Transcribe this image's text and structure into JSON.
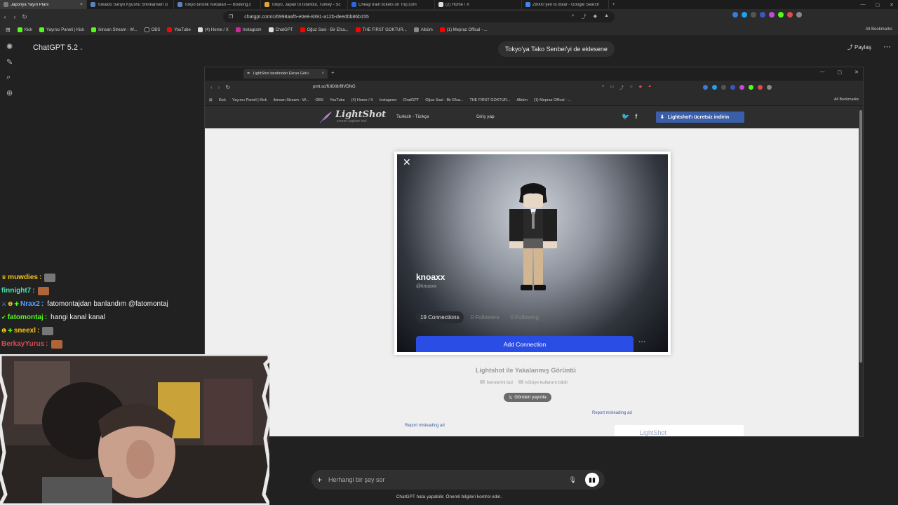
{
  "outer_tabs": [
    {
      "title": "Japonya Yayın Planı",
      "color": "#7a7a7a",
      "active": true
    },
    {
      "title": "Tokaido Sanyo Kyushu Shinkansen G",
      "color": "#5f7fbf",
      "active": false
    },
    {
      "title": "Tokyo turistik noktaları — Booking.c",
      "color": "#5f7fbf",
      "active": false
    },
    {
      "title": "Tokyo, Japan to Istanbul, Turkey - Sc",
      "color": "#e2a33b",
      "active": false
    },
    {
      "title": "Cheap train tickets on Trip.com",
      "color": "#2b67d8",
      "active": false
    },
    {
      "title": "(2) Home / X",
      "color": "#dddddd",
      "active": false
    },
    {
      "title": "29000 yen to dolar - Google Search",
      "color": "#4285f4",
      "active": false
    }
  ],
  "outer_url": "chatgpt.com/c/6998aaf5-e0e8-8391-a12b-deed0b86b155",
  "bookmarks": [
    {
      "label": "Kick",
      "color": "#53fc18"
    },
    {
      "label": "Yayıncı Paneli | Kick",
      "color": "#53fc18"
    },
    {
      "label": "ikinsan Stream - W...",
      "color": "#53fc18"
    },
    {
      "label": "OBS",
      "color": "#222222"
    },
    {
      "label": "YouTube",
      "color": "#ff0000"
    },
    {
      "label": "(4) Home / X",
      "color": "#dddddd"
    },
    {
      "label": "Instagram",
      "color": "#d6249f"
    },
    {
      "label": "ChatGPT",
      "color": "#dddddd"
    },
    {
      "label": "Oğuz Sasi - Bir Efsa...",
      "color": "#ff0000"
    },
    {
      "label": "THE FIRST GOKTUR...",
      "color": "#ff0000"
    },
    {
      "label": "Albüm",
      "color": "#888888"
    },
    {
      "label": "(1) Mepraz Offical - ...",
      "color": "#ff0000"
    }
  ],
  "all_bookmarks": "All Bookmarks",
  "chatgpt": {
    "model": "ChatGPT 5.2",
    "user_message": "Tokyo'ya Tako Senbei'yi de eklesene",
    "share": "Paylaş",
    "placeholder": "Herhangi bir şey sor",
    "disclaimer": "ChatGPT hata yapabilir. Önemli bilgileri kontrol edin."
  },
  "inner_browser": {
    "tab_title": "LightShot tarafından Ekran Görü",
    "url": "prnt.sc/fU6X8rf9VDNG",
    "bookmarks": [
      "Kick",
      "Yayıncı Paneli | Kick",
      "ikinsan Stream - W...",
      "OBS",
      "YouTube",
      "(4) Home / X",
      "Instagram",
      "ChatGPT",
      "Oğuz Sasi - Bir Efsa...",
      "THE FIRST GOKTUR...",
      "Albüm",
      "(1) Mepraz Offical - ..."
    ],
    "all_bookmarks": "All Bookmarks"
  },
  "lightshot": {
    "brand": "LightShot",
    "tagline": "screen capture tool",
    "lang": "Turkish - Türkçe",
    "login": "Giriş yap",
    "download": "Lightshot'ı ücretsiz indirin",
    "title": "Lightshot ile Yakalanmış Görüntü",
    "similar": "benzerini bul",
    "report_abuse": "kötüye kullanım bildir",
    "tweet": "Gönderi yayınla",
    "report_ad_1": "Report misleading ad",
    "report_ad_2": "Report misleading ad",
    "ad_brand": "LightShot"
  },
  "profile_card": {
    "name": "knoaxx",
    "handle": "@knoaxx",
    "connections": "19 Connections",
    "followers": "0 Followers",
    "following": "0 Following",
    "add_connection": "Add Connection"
  },
  "stream_chat": [
    {
      "badge": "",
      "user": "muwdies",
      "color": "#f5c518",
      "msg": ""
    },
    {
      "badge": "",
      "user": "finnight7",
      "color": "#4fe0b0",
      "msg": ""
    },
    {
      "badge": "",
      "user": "Nrax2",
      "color": "#5aa0ff",
      "msg": "fatomontajdan banlandım @fatomontaj"
    },
    {
      "badge": "",
      "user": "fatomontaj",
      "color": "#53fc18",
      "msg": "hangi kanal kanal"
    },
    {
      "badge": "",
      "user": "sneexl",
      "color": "#f5c518",
      "msg": ""
    },
    {
      "badge": "",
      "user": "BerkayYurus",
      "color": "#e0484a",
      "msg": ""
    }
  ]
}
